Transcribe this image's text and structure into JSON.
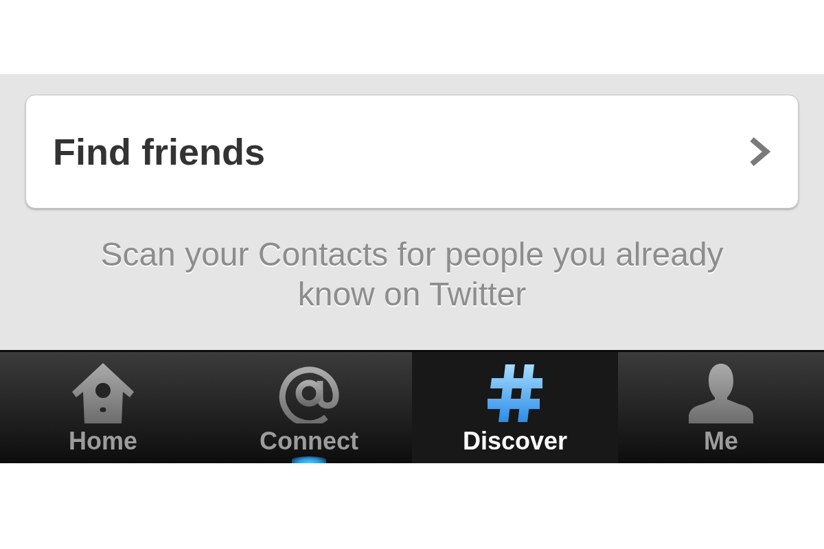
{
  "find_friends": {
    "label": "Find friends"
  },
  "caption": "Scan your Contacts for people you already know on Twitter",
  "tabs": [
    {
      "label": "Home",
      "kind": "home",
      "selected": false,
      "glow": false
    },
    {
      "label": "Connect",
      "kind": "connect",
      "selected": false,
      "glow": true
    },
    {
      "label": "Discover",
      "kind": "discover",
      "selected": true,
      "glow": false
    },
    {
      "label": "Me",
      "kind": "me",
      "selected": false,
      "glow": false
    }
  ]
}
